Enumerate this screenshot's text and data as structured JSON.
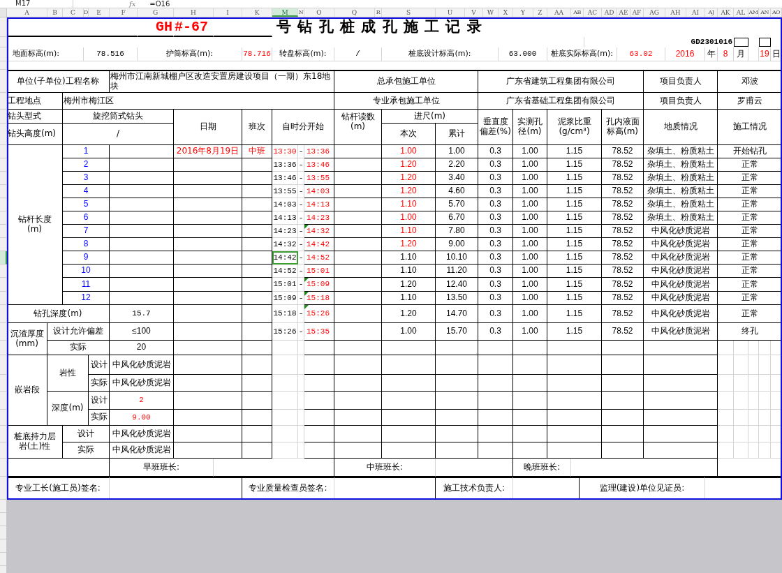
{
  "formula_bar": {
    "name_box": "M17",
    "fx": "fx",
    "formula": "=O16"
  },
  "column_headers": [
    {
      "label": "A",
      "selected": false
    },
    {
      "label": "B",
      "selected": false
    },
    {
      "label": "C",
      "selected": false
    },
    {
      "label": "D",
      "selected": false
    },
    {
      "label": "E",
      "selected": false
    },
    {
      "label": "F",
      "selected": false
    },
    {
      "label": "G",
      "selected": false
    },
    {
      "label": "H",
      "selected": false
    },
    {
      "label": "I",
      "selected": false
    },
    {
      "label": "K",
      "selected": false
    },
    {
      "label": "M",
      "selected": true
    },
    {
      "label": "N",
      "selected": false
    },
    {
      "label": "O",
      "selected": false
    },
    {
      "label": "Q",
      "selected": false
    },
    {
      "label": "R",
      "selected": false
    },
    {
      "label": "S",
      "selected": false
    },
    {
      "label": "U",
      "selected": false
    },
    {
      "label": "V",
      "selected": false
    },
    {
      "label": "W",
      "selected": false
    },
    {
      "label": "X",
      "selected": false
    },
    {
      "label": "Y",
      "selected": false
    },
    {
      "label": "Z",
      "selected": false
    },
    {
      "label": "AA",
      "selected": false
    },
    {
      "label": "AB",
      "selected": false
    },
    {
      "label": "AC",
      "selected": false
    },
    {
      "label": "AD",
      "selected": false
    },
    {
      "label": "AE",
      "selected": false
    },
    {
      "label": "AF",
      "selected": false
    },
    {
      "label": "AG",
      "selected": false
    },
    {
      "label": "AH",
      "selected": false
    },
    {
      "label": "AI",
      "selected": false
    },
    {
      "label": "AJ",
      "selected": false
    },
    {
      "label": "AK",
      "selected": false
    },
    {
      "label": "AL",
      "selected": false
    },
    {
      "label": "AM",
      "selected": false
    },
    {
      "label": "AN",
      "selected": false
    },
    {
      "label": "AO",
      "selected": false
    }
  ],
  "form": {
    "code_prefix": "GH",
    "hole_no": "#-67",
    "title": "号 钻 孔 桩 成 孔 施 工 记 录",
    "doc_no": "GD2301016",
    "elevations": [
      {
        "label": "地面标高(m):",
        "value": "78.516",
        "red": false
      },
      {
        "label": "护筒标高(m):",
        "value": "78.716",
        "red": true
      },
      {
        "label": "转盘标高(m):",
        "value": "/",
        "red": false
      },
      {
        "label": "桩底设计标高(m):",
        "value": "63.000",
        "red": false
      },
      {
        "label": "桩底实际标高(m):",
        "value": "63.02",
        "red": true
      }
    ],
    "date": {
      "year": "2016",
      "year_unit": "年",
      "month": "8",
      "month_unit": "月",
      "day": "19",
      "day_unit": "日"
    },
    "project": {
      "name_label": "单位(子单位)工程名称",
      "name": "梅州市江南新城棚户区改造安置房建设项目（一期）东18地块",
      "site_label": "工程地点",
      "site": "梅州市梅江区"
    },
    "contractors": [
      {
        "label": "总承包施工单位",
        "company": "广东省建筑工程集团有限公司",
        "manager_label": "项目负责人",
        "manager": "邓波"
      },
      {
        "label": "专业承包施工单位",
        "company": "广东省基础工程集团有限公司",
        "manager_label": "项目负责人",
        "manager": "罗甫云"
      }
    ],
    "bit": {
      "type_label": "钻头型式",
      "type": "旋挖筒式钻头",
      "height_label": "钻头高度(m)",
      "height": "/"
    },
    "headers": {
      "date": "日期",
      "shift": "班次",
      "time": "自时分开始",
      "reading": "钻杆读数\n(m)",
      "advance": "进尺(m)",
      "this": "本次",
      "total": "累计",
      "vertical": "垂直度偏差(%)",
      "diameter": "实测孔径(m)",
      "mud": "泥浆比重\n(g/cm³)",
      "liquid": "孔内液面标高(m)",
      "geology": "地质情况",
      "status": "施工情况"
    },
    "rod_length_label": "钻杆长度\n(m)",
    "rows": [
      {
        "no": "1",
        "date": "2016年8月19日",
        "shift": "中班",
        "start": "13:30",
        "start_red": true,
        "sep": "-",
        "end": "13:36",
        "this": "1.00",
        "this_red": true,
        "total": "1.00",
        "vertical": "0.3",
        "diameter": "1.00",
        "mud": "1.15",
        "liquid": "78.52",
        "geology": "杂填土、粉质粘土",
        "status": "开始钻孔",
        "selected": false,
        "flag": false
      },
      {
        "no": "2",
        "start": "13:36",
        "start_red": false,
        "sep": "-",
        "end": "13:46",
        "this": "1.20",
        "this_red": true,
        "total": "2.20",
        "vertical": "0.3",
        "diameter": "1.00",
        "mud": "1.15",
        "liquid": "78.52",
        "geology": "杂填土、粉质粘土",
        "status": "正常",
        "selected": false,
        "flag": false
      },
      {
        "no": "3",
        "start": "13:46",
        "start_red": false,
        "sep": "-",
        "end": "13:55",
        "this": "1.20",
        "this_red": true,
        "total": "3.40",
        "vertical": "0.3",
        "diameter": "1.00",
        "mud": "1.15",
        "liquid": "78.52",
        "geology": "杂填土、粉质粘土",
        "status": "正常",
        "selected": false,
        "flag": false
      },
      {
        "no": "4",
        "start": "13:55",
        "start_red": false,
        "sep": "-",
        "end": "14:03",
        "this": "1.20",
        "this_red": true,
        "total": "4.60",
        "vertical": "0.3",
        "diameter": "1.00",
        "mud": "1.15",
        "liquid": "78.52",
        "geology": "杂填土、粉质粘土",
        "status": "正常",
        "selected": false,
        "flag": false
      },
      {
        "no": "5",
        "start": "14:03",
        "start_red": false,
        "sep": "-",
        "end": "14:13",
        "this": "1.10",
        "this_red": true,
        "total": "5.70",
        "vertical": "0.3",
        "diameter": "1.00",
        "mud": "1.15",
        "liquid": "78.52",
        "geology": "杂填土、粉质粘土",
        "status": "正常",
        "selected": false,
        "flag": false
      },
      {
        "no": "6",
        "start": "14:13",
        "start_red": false,
        "sep": "-",
        "end": "14:23",
        "this": "1.00",
        "this_red": true,
        "total": "6.70",
        "vertical": "0.3",
        "diameter": "1.00",
        "mud": "1.15",
        "liquid": "78.52",
        "geology": "杂填土、粉质粘土",
        "status": "正常",
        "selected": false,
        "flag": false
      },
      {
        "no": "7",
        "start": "14:23",
        "start_red": false,
        "sep": "-",
        "end": "14:32",
        "this": "1.10",
        "this_red": true,
        "total": "7.80",
        "vertical": "0.3",
        "diameter": "1.00",
        "mud": "1.15",
        "liquid": "78.52",
        "geology": "中风化砂质泥岩",
        "status": "正常",
        "selected": false,
        "flag": true
      },
      {
        "no": "8",
        "start": "14:32",
        "start_red": false,
        "sep": "-",
        "end": "14:42",
        "this": "1.20",
        "this_red": true,
        "total": "9.00",
        "vertical": "0.3",
        "diameter": "1.00",
        "mud": "1.15",
        "liquid": "78.52",
        "geology": "中风化砂质泥岩",
        "status": "正常",
        "selected": false,
        "flag": false
      },
      {
        "no": "9",
        "start": "14:42",
        "start_red": false,
        "sep": "-",
        "end": "14:52",
        "this": "1.10",
        "this_red": false,
        "total": "10.10",
        "vertical": "0.3",
        "diameter": "1.00",
        "mud": "1.15",
        "liquid": "78.52",
        "geology": "中风化砂质泥岩",
        "status": "正常",
        "selected": true,
        "flag": false
      },
      {
        "no": "10",
        "start": "14:52",
        "start_red": false,
        "sep": "-",
        "end": "15:01",
        "this": "1.10",
        "this_red": false,
        "total": "11.20",
        "vertical": "0.3",
        "diameter": "1.00",
        "mud": "1.15",
        "liquid": "78.52",
        "geology": "中风化砂质泥岩",
        "status": "正常",
        "selected": false,
        "flag": false
      },
      {
        "no": "11",
        "start": "15:01",
        "start_red": false,
        "sep": "-",
        "end": "15:09",
        "this": "1.20",
        "this_red": false,
        "total": "12.40",
        "vertical": "0.3",
        "diameter": "1.00",
        "mud": "1.15",
        "liquid": "78.52",
        "geology": "中风化砂质泥岩",
        "status": "正常",
        "selected": false,
        "flag": true
      },
      {
        "no": "12",
        "start": "15:09",
        "start_red": false,
        "sep": "-",
        "end": "15:18",
        "this": "1.10",
        "this_red": false,
        "total": "13.50",
        "vertical": "0.3",
        "diameter": "1.00",
        "mud": "1.15",
        "liquid": "78.52",
        "geology": "中风化砂质泥岩",
        "status": "正常",
        "selected": false,
        "flag": true
      },
      {
        "start": "15:18",
        "start_red": false,
        "sep": "-",
        "end": "15:26",
        "this": "1.20",
        "this_red": false,
        "total": "14.70",
        "vertical": "0.3",
        "diameter": "1.00",
        "mud": "1.15",
        "liquid": "78.52",
        "geology": "中风化砂质泥岩",
        "status": "正常",
        "selected": false,
        "flag": true
      },
      {
        "start": "15:26",
        "start_red": false,
        "sep": "-",
        "end": "15:35",
        "this": "1.00",
        "this_red": false,
        "total": "15.70",
        "vertical": "0.3",
        "diameter": "1.00",
        "mud": "1.15",
        "liquid": "78.52",
        "geology": "中风化砂质泥岩",
        "status": "终孔",
        "selected": false,
        "flag": false
      }
    ],
    "depth": {
      "label": "钻孔深度(m)",
      "value": "15.7"
    },
    "sediment": {
      "label": "沉渣厚度\n(mm)",
      "rows": [
        {
          "label": "设计允许偏差",
          "value": "≤100"
        },
        {
          "label": "实际",
          "value": "20"
        }
      ]
    },
    "socket": {
      "label": "嵌岩段",
      "groups": [
        {
          "label": "岩性",
          "rows": [
            {
              "label": "设计",
              "value": "中风化砂质泥岩",
              "red": false
            },
            {
              "label": "实际",
              "value": "中风化砂质泥岩",
              "red": false
            }
          ]
        },
        {
          "label": "深度(m)",
          "rows": [
            {
              "label": "设计",
              "value": "2",
              "red": true
            },
            {
              "label": "实际",
              "value": "9.00",
              "red": true
            }
          ]
        }
      ]
    },
    "bearing": {
      "label": "桩底持力层岩(土)性",
      "rows": [
        {
          "label": "设计",
          "value": "中风化砂质泥岩"
        },
        {
          "label": "实际",
          "value": "中风化砂质泥岩"
        }
      ]
    },
    "shift_leaders": [
      "早班班长:",
      "中班班长:",
      "晚班班长:"
    ],
    "signatures": [
      "专业工长(施工员)签名:",
      "专业质量检查员签名:",
      "施工技术负责人:",
      "监理(建设)单位见证员:"
    ]
  }
}
